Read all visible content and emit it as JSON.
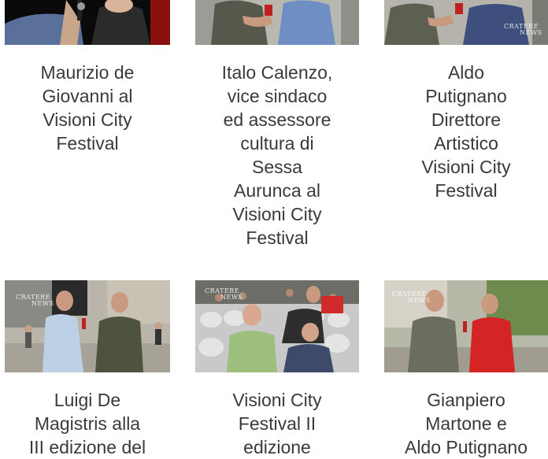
{
  "cards": [
    {
      "title": "Maurizio de\nGiovanni al\nVisioni City\nFestival"
    },
    {
      "title": "Italo Calenzo,\nvice sindaco\ned assessore\ncultura di\nSessa\nAurunca al\nVisioni City\nFestival"
    },
    {
      "title": "Aldo\nPutignano\nDirettore\nArtistico\nVisioni City\nFestival"
    },
    {
      "title": "Luigi De\nMagistris alla\nIII edizione del"
    },
    {
      "title": "Visioni City\nFestival II\nedizione"
    },
    {
      "title": "Gianpiero\nMartone e\nAldo Putignano"
    }
  ],
  "watermark": {
    "line1": "CRATERE",
    "line2": "NEWS"
  }
}
